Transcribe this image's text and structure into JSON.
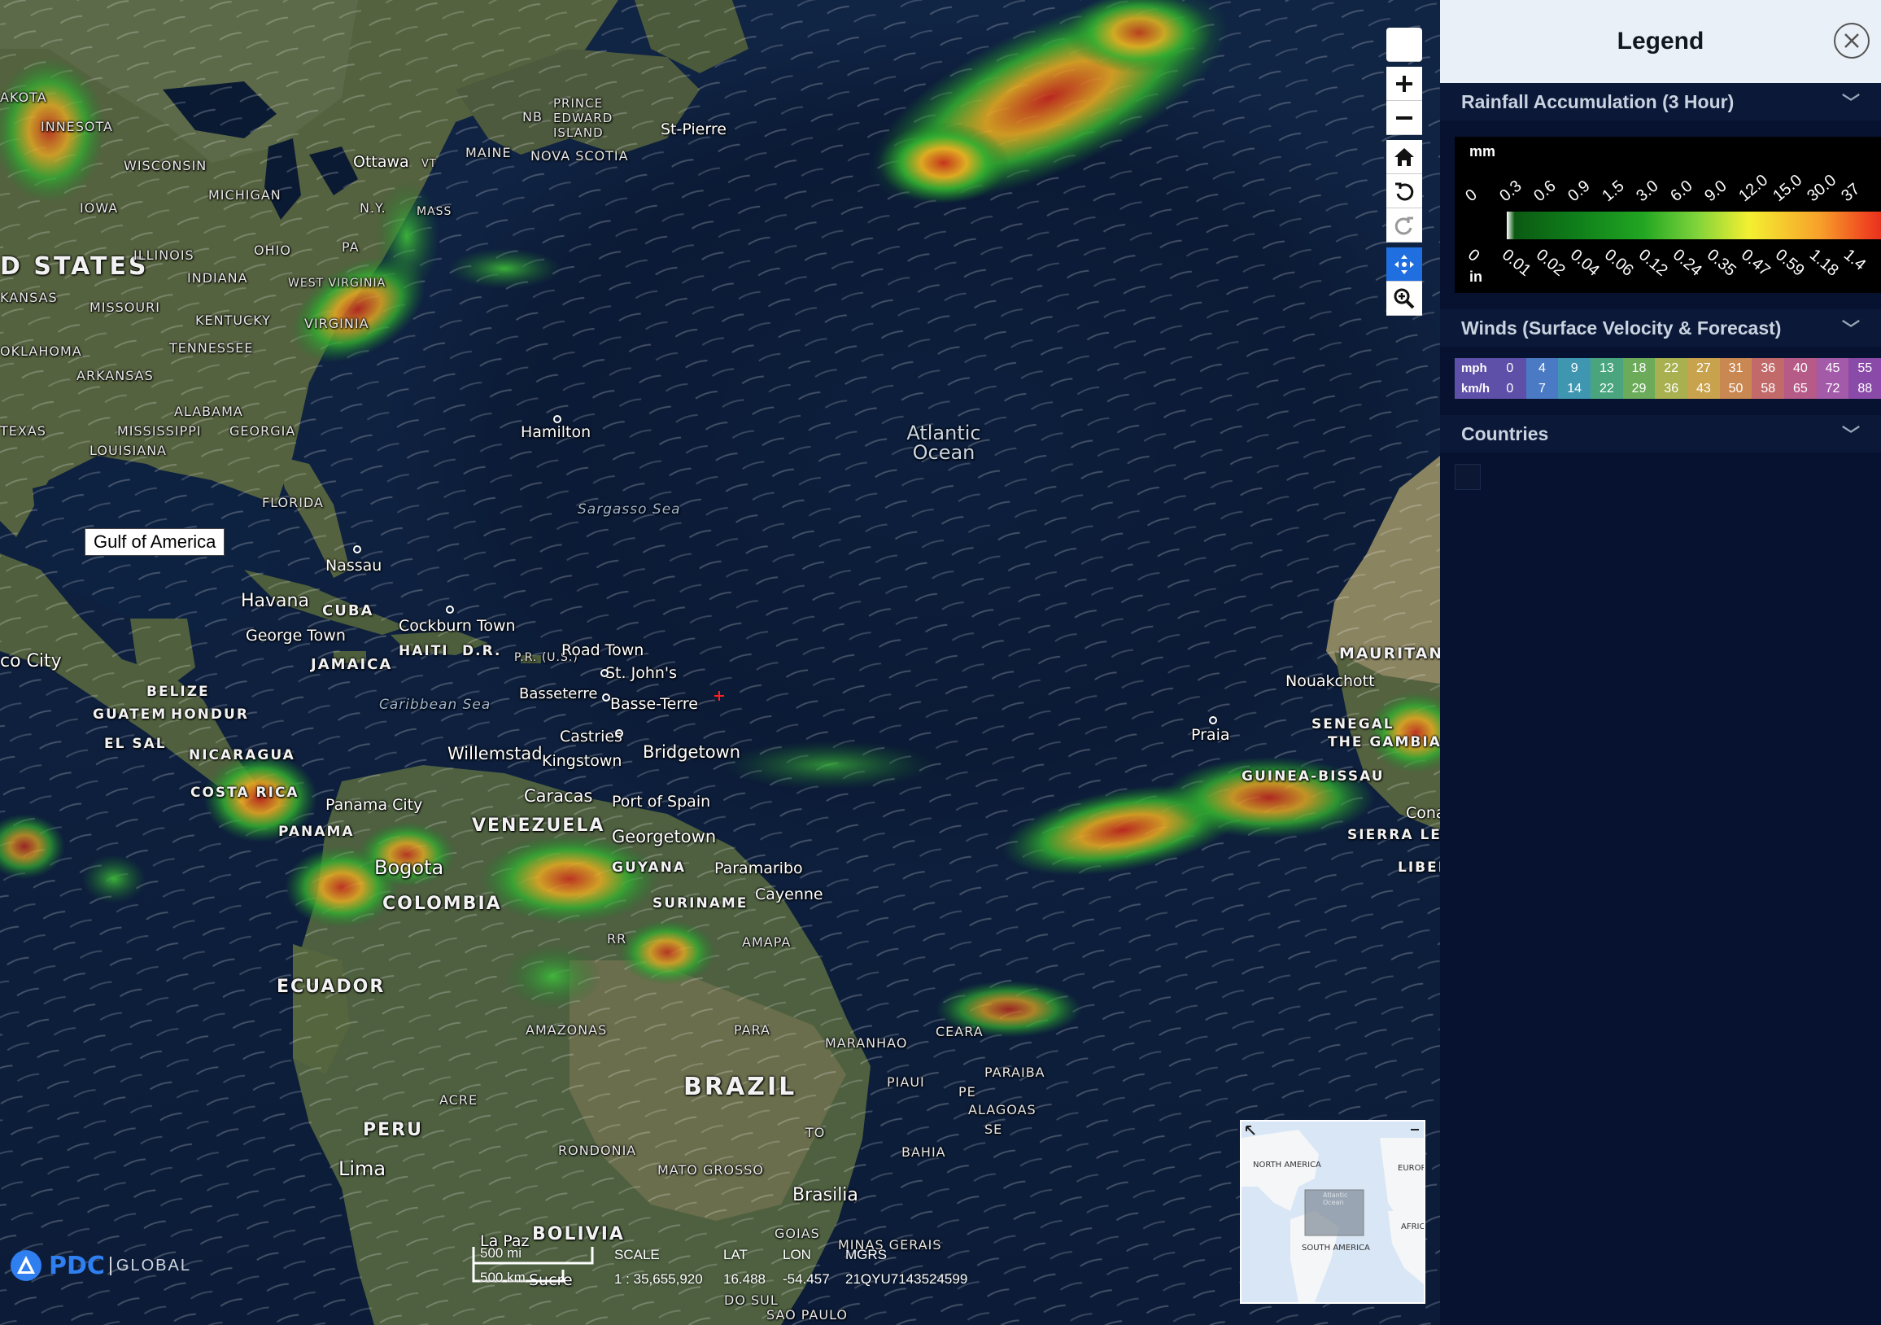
{
  "map": {
    "gulf_label": "Gulf of America",
    "country_labels": [
      "D STATES",
      "BRAZIL",
      "VENEZUELA",
      "COLOMBIA",
      "ECUADOR",
      "PERU",
      "BOLIVIA",
      "CUBA",
      "JAMAICA",
      "HAITI",
      "D.R.",
      "BELIZE",
      "GUATEM",
      "HONDUR",
      "EL SAL",
      "NICARAGUA",
      "COSTA RICA",
      "PANAMA",
      "GUYANA",
      "SURINAME",
      "SENEGAL",
      "THE GAMBIA",
      "GUINEA-BISSAU",
      "SIERRA LEONE",
      "LIBER",
      "MAURITAN",
      "P.R. (U.S.)"
    ],
    "state_labels": [
      "AKOTA",
      "INNESOTA",
      "WISCONSIN",
      "MICHIGAN",
      "IOWA",
      "ILLINOIS",
      "INDIANA",
      "OHIO",
      "PA",
      "N.Y.",
      "KANSAS",
      "MISSOURI",
      "KENTUCKY",
      "WEST VIRGINIA",
      "VIRGINIA",
      "OKLAHOMA",
      "TENNESSEE",
      "ARKANSAS",
      "ALABAMA",
      "MISSISSIPPI",
      "GEORGIA",
      "TEXAS",
      "LOUISIANA",
      "FLORIDA",
      "MAINE",
      "VT",
      "MASS",
      "NB",
      "PRINCE EDWARD ISLAND",
      "NOVA SCOTIA",
      "AMAZONAS",
      "PARA",
      "MARANHAO",
      "CEARA",
      "PIAUI",
      "PARAIBA",
      "PE",
      "ALAGOAS",
      "SE",
      "TO",
      "BAHIA",
      "MATO GROSSO",
      "RONDONIA",
      "ACRE",
      "GOIAS",
      "MINAS GERAIS",
      "AMAPA",
      "RR",
      "DO SUL",
      "SAO PAULO"
    ],
    "city_labels": [
      "Ottawa",
      "St-Pierre",
      "Hamilton",
      "Nassau",
      "Havana",
      "George Town",
      "Cockburn Town",
      "Road Town",
      "St. John's",
      "Basseterre",
      "Basse-Terre",
      "Castries",
      "Bridgetown",
      "Willemstad",
      "Kingstown",
      "Caracas",
      "Port of Spain",
      "Georgetown",
      "Paramaribo",
      "Cayenne",
      "Panama City",
      "Bogota",
      "Lima",
      "La Paz",
      "Sucre",
      "Brasilia",
      "Nouakchott",
      "Praia",
      "Conakr",
      "co City"
    ],
    "sea_labels": [
      "Sargasso Sea",
      "Caribbean Sea"
    ],
    "ocean_label": "Atlantic Ocean",
    "controls": [
      "blank-button",
      "zoom-in",
      "zoom-out",
      "home",
      "rotate-left",
      "rotate-right",
      "pan",
      "zoom-box"
    ],
    "overview_labels": [
      "NORTH AMERICA",
      "EUROP",
      "Atlantic Ocean",
      "AFRIC",
      "SOUTH AMERICA"
    ],
    "scale": {
      "mi": "500 mi",
      "km": "500 km"
    },
    "coords": {
      "scale_label": "SCALE",
      "lat_label": "LAT",
      "lon_label": "LON",
      "mgrs_label": "MGRS",
      "scale_value": "1 : 35,655,920",
      "lat_value": "16.488",
      "lon_value": "-54.457",
      "mgrs_value": "21QYU7143524599"
    },
    "logo": {
      "pdc": "PDC",
      "global": "GLOBAL"
    }
  },
  "legend": {
    "title": "Legend",
    "sections": {
      "rain": "Rainfall Accumulation (3 Hour)",
      "winds": "Winds (Surface Velocity & Forecast)",
      "countries": "Countries"
    },
    "rain_mm_label": "mm",
    "rain_in_label": "in",
    "rain_mm_ticks": [
      "0",
      "0.3",
      "0.6",
      "0.9",
      "1.5",
      "3.0",
      "6.0",
      "9.0",
      "12.0",
      "15.0",
      "30.0",
      "37"
    ],
    "rain_in_ticks": [
      "0",
      "0.01",
      "0.02",
      "0.04",
      "0.06",
      "0.12",
      "0.24",
      "0.35",
      "0.47",
      "0.59",
      "1.18",
      "1.4"
    ],
    "winds_mph_label": "mph",
    "winds_kmh_label": "km/h",
    "winds_mph": [
      "0",
      "4",
      "9",
      "13",
      "18",
      "22",
      "27",
      "31",
      "36",
      "40",
      "45",
      "55"
    ],
    "winds_kmh": [
      "0",
      "7",
      "14",
      "22",
      "29",
      "36",
      "43",
      "50",
      "58",
      "65",
      "72",
      "88"
    ],
    "winds_colors": [
      "#5e4fa8",
      "#4a7ac4",
      "#3f96b0",
      "#4aa57f",
      "#6bab5a",
      "#a8b04f",
      "#c9a24d",
      "#c98751",
      "#c26a6a",
      "#b65a88",
      "#a35aa8",
      "#8a4aa8"
    ]
  }
}
